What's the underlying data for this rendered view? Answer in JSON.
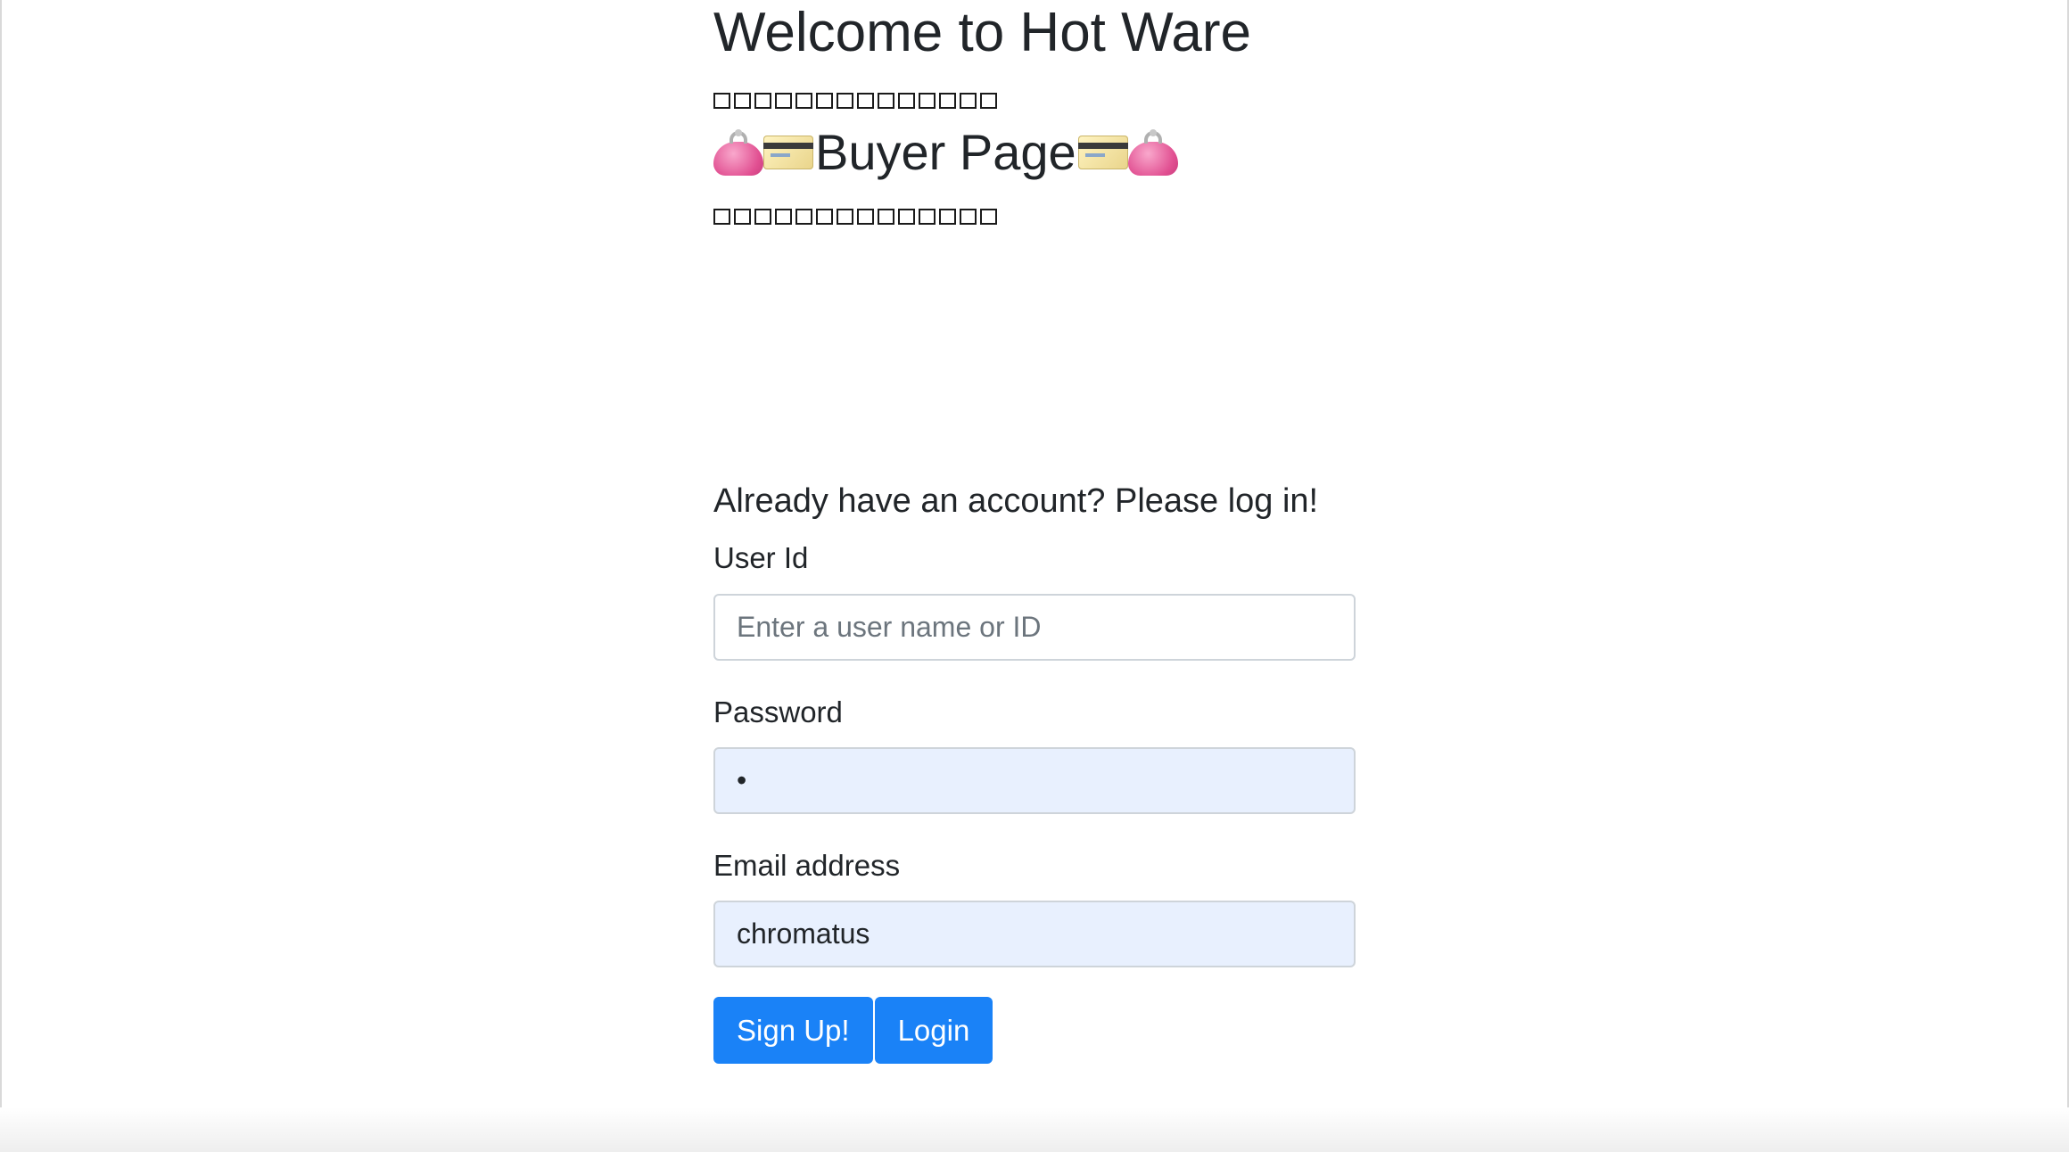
{
  "header": {
    "welcome_title": "Welcome to Hot Ware",
    "buyer_title": "Buyer Page"
  },
  "icons": {
    "purse": "purse-icon",
    "credit_card": "credit-card-icon",
    "missing_glyph": "missing-glyph-box"
  },
  "login": {
    "heading": "Already have an account? Please log in!",
    "user_id_label": "User Id",
    "user_id_placeholder": "Enter a user name or ID",
    "user_id_value": "",
    "password_label": "Password",
    "password_value": "•",
    "email_label": "Email address",
    "email_value": "chromatus",
    "signup_button": "Sign Up!",
    "login_button": "Login"
  },
  "colors": {
    "primary_button": "#1a82f7",
    "autofill_background": "#e8f0fe",
    "text": "#212529",
    "placeholder": "#6c757d"
  }
}
